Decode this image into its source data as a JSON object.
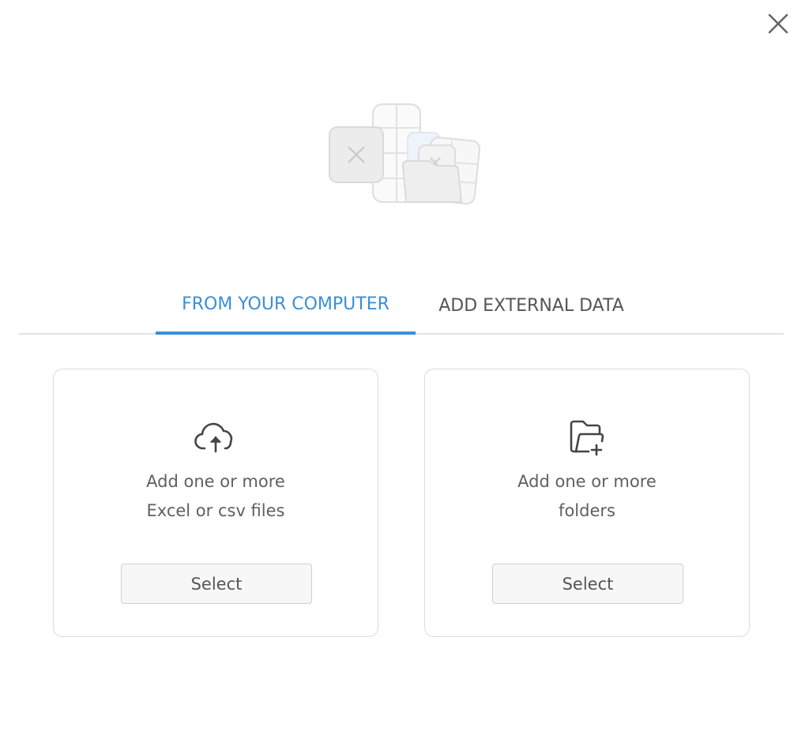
{
  "close_icon": "close-icon",
  "tabs": [
    {
      "label": "FROM YOUR COMPUTER",
      "active": true
    },
    {
      "label": "ADD EXTERNAL DATA",
      "active": false
    }
  ],
  "cards": [
    {
      "icon": "cloud-upload-icon",
      "line1": "Add one or more",
      "line2": "Excel or csv files",
      "button": "Select"
    },
    {
      "icon": "folder-add-icon",
      "line1": "Add one or more",
      "line2": "folders",
      "button": "Select"
    }
  ],
  "colors": {
    "accent": "#3c8fd4",
    "text": "#5f5f5f",
    "border": "#dcdcdc"
  }
}
